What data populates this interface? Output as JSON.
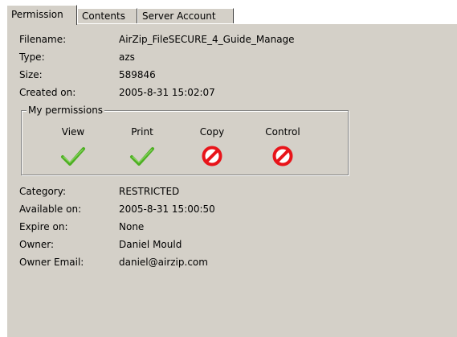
{
  "tabs": [
    {
      "label": "Permission",
      "active": true
    },
    {
      "label": "Contents",
      "active": false
    },
    {
      "label": "Server Account",
      "active": false
    }
  ],
  "file_info": [
    {
      "label": "Filename:",
      "value": "AirZip_FileSECURE_4_Guide_Manage"
    },
    {
      "label": "Type:",
      "value": "azs"
    },
    {
      "label": "Size:",
      "value": "589846"
    },
    {
      "label": "Created on:",
      "value": "2005-8-31 15:02:07"
    }
  ],
  "permissions": {
    "title": "My permissions",
    "items": [
      {
        "label": "View",
        "allowed": true,
        "icon": "checkmark-icon"
      },
      {
        "label": "Print",
        "allowed": true,
        "icon": "checkmark-icon"
      },
      {
        "label": "Copy",
        "allowed": false,
        "icon": "prohibited-icon"
      },
      {
        "label": "Control",
        "allowed": false,
        "icon": "prohibited-icon"
      }
    ]
  },
  "policy_info": [
    {
      "label": "Category:",
      "value": "RESTRICTED"
    },
    {
      "label": "Available on:",
      "value": "2005-8-31 15:00:50"
    },
    {
      "label": "Expire on:",
      "value": "None"
    },
    {
      "label": "Owner:",
      "value": "Daniel Mould"
    },
    {
      "label": "Owner Email:",
      "value": "daniel@airzip.com"
    }
  ],
  "colors": {
    "panel_bg": "#d4d0c8",
    "allowed_green": "#4caf22",
    "denied_red": "#e8141a"
  }
}
